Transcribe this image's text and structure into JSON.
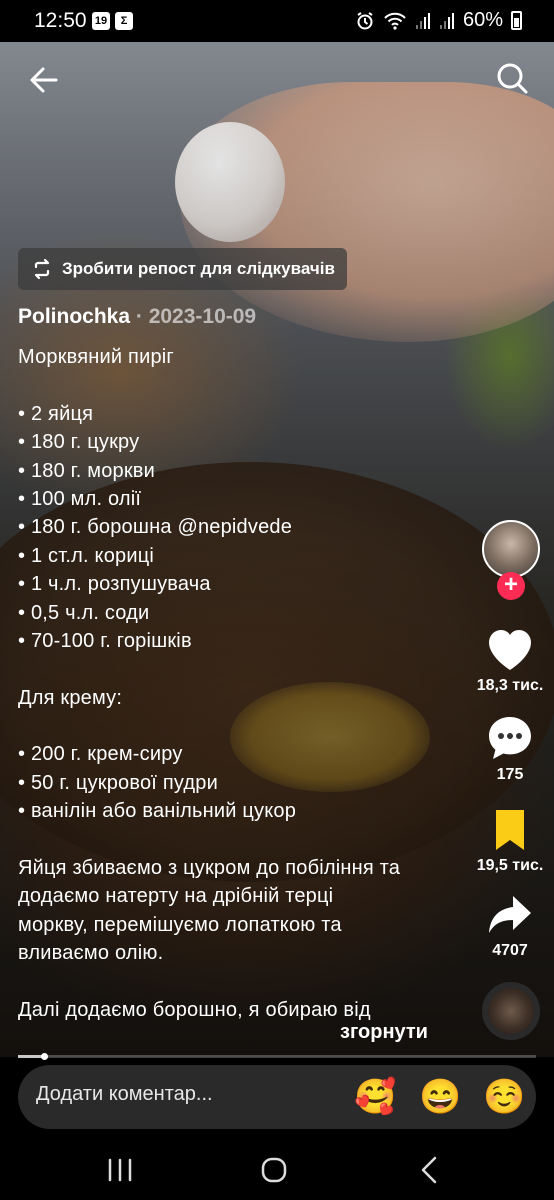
{
  "status_bar": {
    "time": "12:50",
    "badge_1": "19",
    "badge_2": "Σ",
    "battery": "60%",
    "icons": [
      "alarm-icon",
      "wifi-icon",
      "signal-icon",
      "signal-icon",
      "battery-icon"
    ]
  },
  "repost": {
    "label": "Зробити репост для слідкувачів",
    "icon": "repost-icon"
  },
  "post": {
    "author": "Polinochka",
    "date": " · 2023-10-09",
    "caption_lines": [
      "Морквяний пиріг",
      "",
      "• 2 яйця",
      "• 180 г. цукру",
      "• 180 г. моркви",
      "• 100 мл. олії",
      "• 180 г. борошна @nepidvede",
      "• 1 ст.л. кориці",
      "• 1 ч.л. розпушувача",
      "• 0,5 ч.л. соди",
      "• 70-100 г. горішків",
      "",
      "Для крему:",
      "",
      "• 200 г. крем-сиру",
      "• 50 г. цукрової пудри",
      "• ванілін або ванільний цукор",
      "",
      "Яйця збиваємо з цукром до побіління та",
      "додаємо натерту на дрібній терці",
      "моркву, перемішуємо лопаткою та",
      "вливаємо олію.",
      "",
      "Далі додаємо борошно, я обираю від"
    ],
    "collapse_label": "згорнути"
  },
  "actions": {
    "likes": "18,3 тис.",
    "comments": "175",
    "saves": "19,5 тис.",
    "shares": "4707",
    "follow_symbol": "+"
  },
  "progress": {
    "fraction": 0.1
  },
  "comment_bar": {
    "placeholder": "Додати коментар...",
    "emojis": [
      "🥰",
      "😄",
      "☺️"
    ]
  },
  "colors": {
    "accent_red": "#fe2c55",
    "bookmark_yellow": "#facc15",
    "comment_bar": "#2a2a2a"
  }
}
